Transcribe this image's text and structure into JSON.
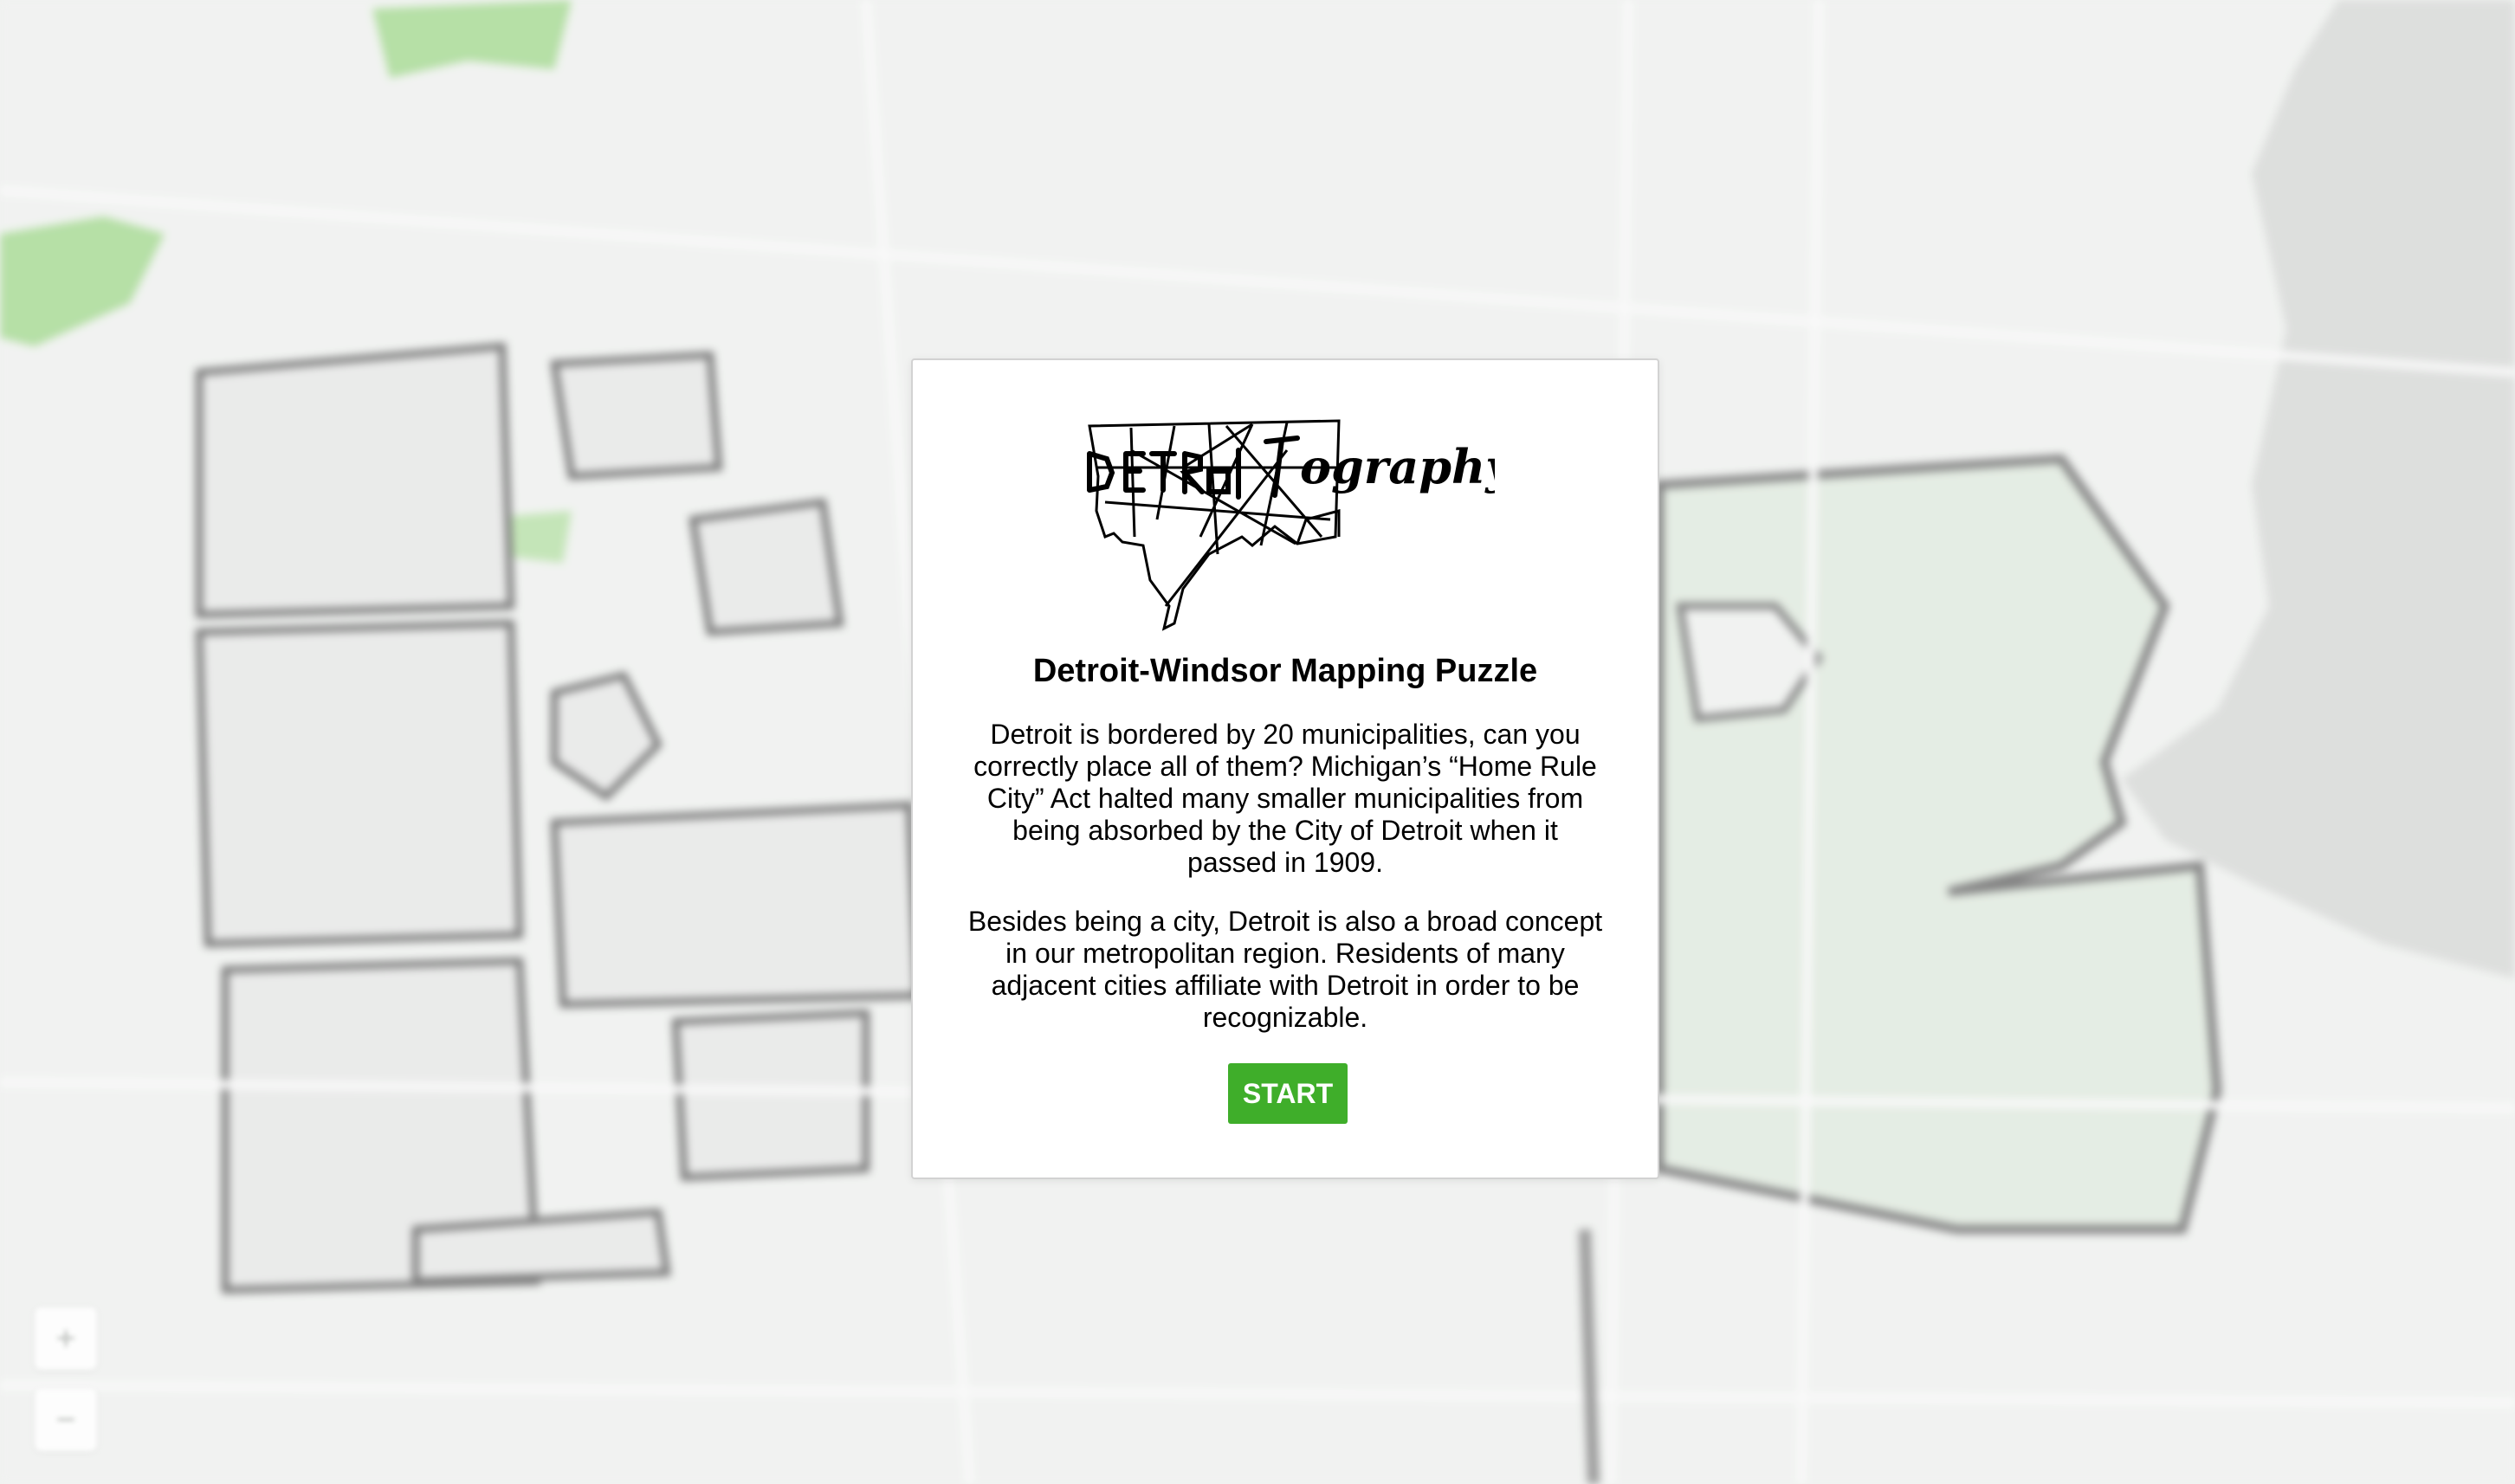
{
  "map": {
    "zoom_in_label": "+",
    "zoom_out_label": "−",
    "colors": {
      "land": "#eef0ee",
      "water": "#d9dbd9",
      "park": "#8fd17a",
      "windsor": "#dfe8df",
      "outline": "#555555"
    }
  },
  "modal": {
    "logo": {
      "wordmark": "DETRoIT",
      "script": "ography"
    },
    "title": "Detroit-Windsor Mapping Puzzle",
    "paragraph_1": "Detroit is bordered by 20 municipalities, can you correctly place all of them? Michigan’s “Home Rule City” Act halted many smaller municipalities from being absorbed by the City of Detroit when it passed in 1909.",
    "paragraph_2": "Besides being a city, Detroit is also a broad concept in our metropolitan region. Residents of many adjacent cities affiliate with Detroit in order to be recognizable.",
    "start_label": "START",
    "start_color": "#3fae2a"
  }
}
